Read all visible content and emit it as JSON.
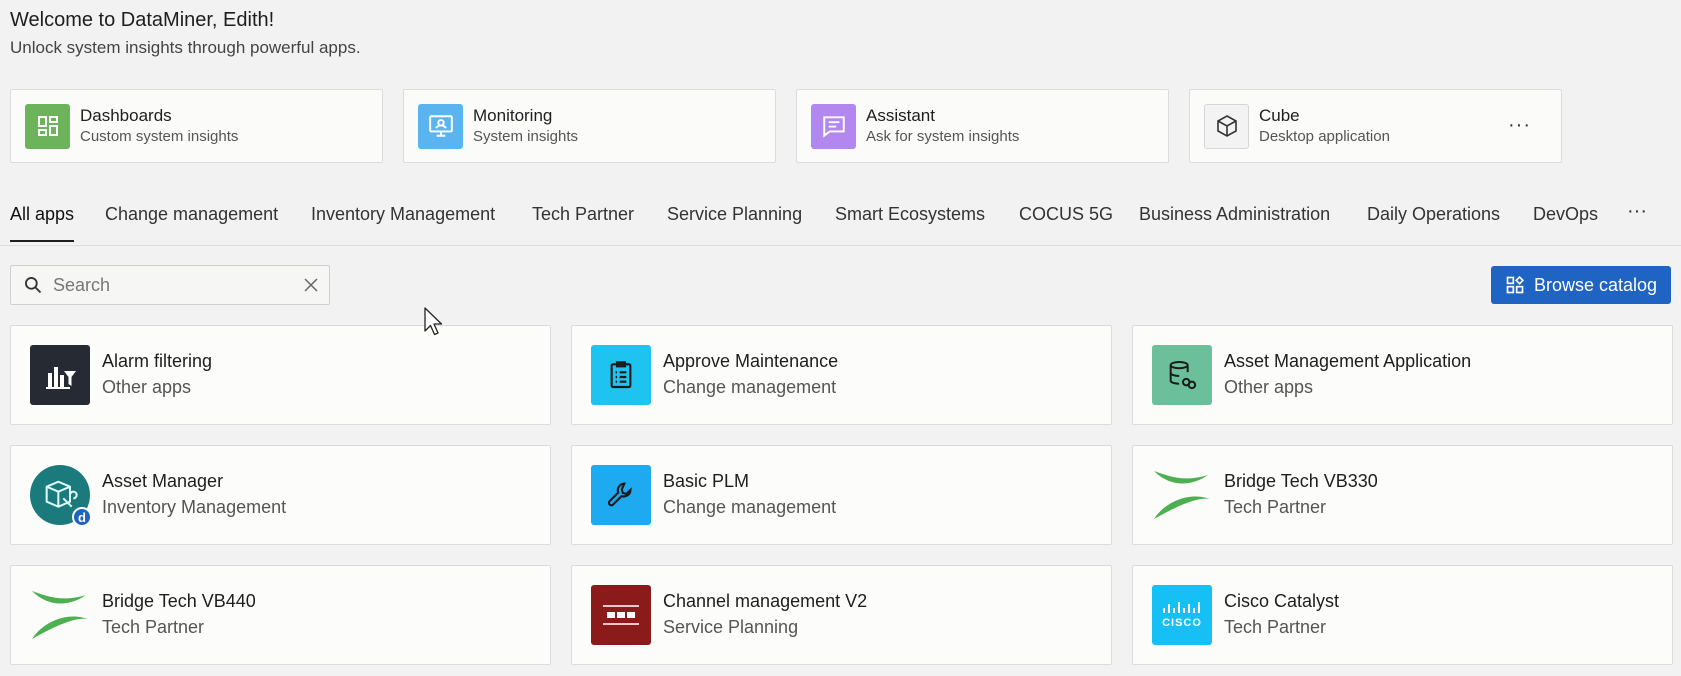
{
  "welcome": {
    "title": "Welcome to DataMiner, Edith!",
    "subtitle": "Unlock system insights through powerful apps."
  },
  "quick_links": [
    {
      "title": "Dashboards",
      "subtitle": "Custom system insights",
      "icon": "dashboard-icon",
      "color": "#6db35c"
    },
    {
      "title": "Monitoring",
      "subtitle": "System insights",
      "icon": "monitoring-icon",
      "color": "#5ab4ef"
    },
    {
      "title": "Assistant",
      "subtitle": "Ask for system insights",
      "icon": "chat-icon",
      "color": "#b287f0"
    },
    {
      "title": "Cube",
      "subtitle": "Desktop application",
      "icon": "cube-icon",
      "color": "#f3f3f3"
    }
  ],
  "quick_more": "···",
  "tabs": [
    "All apps",
    "Change management",
    "Inventory Management",
    "Tech Partner",
    "Service Planning",
    "Smart Ecosystems",
    "COCUS 5G",
    "Business Administration",
    "Daily Operations",
    "DevOps"
  ],
  "tabs_more": "···",
  "search": {
    "placeholder": "Search"
  },
  "browse_label": "Browse catalog",
  "apps": [
    {
      "title": "Alarm filtering",
      "category": "Other apps",
      "icon": "alarm-filter-icon",
      "color": "#262a33"
    },
    {
      "title": "Approve Maintenance",
      "category": "Change management",
      "icon": "clipboard-icon",
      "color": "#1ec3f0"
    },
    {
      "title": "Asset Management Application",
      "category": "Other apps",
      "icon": "database-link-icon",
      "color": "#6bbf9a"
    },
    {
      "title": "Asset Manager",
      "category": "Inventory Management",
      "icon": "asset-manager-icon",
      "color": "#1b7b7c"
    },
    {
      "title": "Basic PLM",
      "category": "Change management",
      "icon": "wrench-icon",
      "color": "#1eaaf0"
    },
    {
      "title": "Bridge Tech VB330",
      "category": "Tech Partner",
      "icon": "bridge-tech-logo-icon",
      "color": "#4caf50"
    },
    {
      "title": "Bridge Tech VB440",
      "category": "Tech Partner",
      "icon": "bridge-tech-logo-icon",
      "color": "#4caf50"
    },
    {
      "title": "Channel management V2",
      "category": "Service Planning",
      "icon": "channel-icon",
      "color": "#8b1a1a"
    },
    {
      "title": "Cisco Catalyst",
      "category": "Tech Partner",
      "icon": "cisco-logo-icon",
      "color": "#16c0f5",
      "logo_text": "CISCO"
    }
  ]
}
